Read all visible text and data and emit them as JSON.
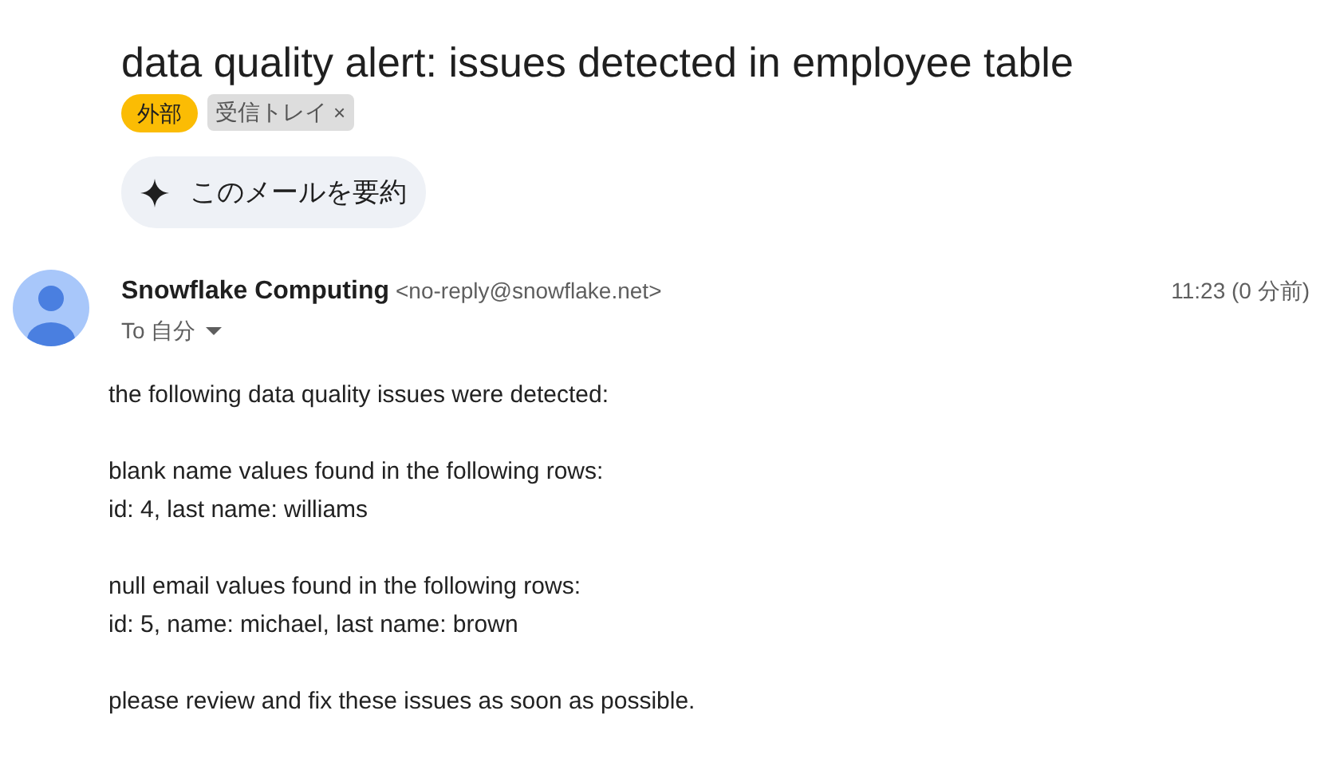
{
  "subject": "data quality alert: issues detected in employee table",
  "labels": [
    {
      "kind": "badge",
      "text": "外部"
    },
    {
      "kind": "removable",
      "text": "受信トレイ",
      "remove": "×"
    }
  ],
  "summary_button": "このメールを要約",
  "sender": {
    "name": "Snowflake Computing",
    "email": "<no-reply@snowflake.net>",
    "to": "To 自分",
    "time": "11:23 (0 分前)"
  },
  "body": [
    [
      "the following data quality issues were detected:"
    ],
    [
      "blank name values found in the following rows:",
      "id: 4, last name: williams"
    ],
    [
      "null email values found in the following rows:",
      "id: 5, name: michael, last name: brown"
    ],
    [
      "please review and fix these issues as soon as possible."
    ]
  ]
}
